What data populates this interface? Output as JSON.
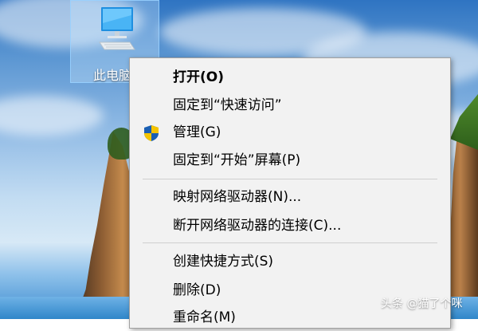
{
  "desktop": {
    "icon": {
      "label": "此电脑",
      "icon_name": "computer-icon"
    }
  },
  "context_menu": {
    "items": [
      {
        "label": "打开(O)",
        "bold": true
      },
      {
        "label": "固定到“快速访问”"
      },
      {
        "label": "管理(G)",
        "icon_name": "uac-shield-icon"
      },
      {
        "label": "固定到“开始”屏幕(P)"
      },
      {
        "label": "映射网络驱动器(N)..."
      },
      {
        "label": "断开网络驱动器的连接(C)..."
      },
      {
        "label": "创建快捷方式(S)"
      },
      {
        "label": "删除(D)"
      },
      {
        "label": "重命名(M)"
      }
    ]
  },
  "watermark": {
    "text": "头条 @猫了个咪"
  },
  "colors": {
    "menu_background": "#f2f2f2",
    "selection_highlight": "#cce8ff",
    "shield_blue": "#1a5fb4",
    "shield_yellow": "#f5c400"
  }
}
